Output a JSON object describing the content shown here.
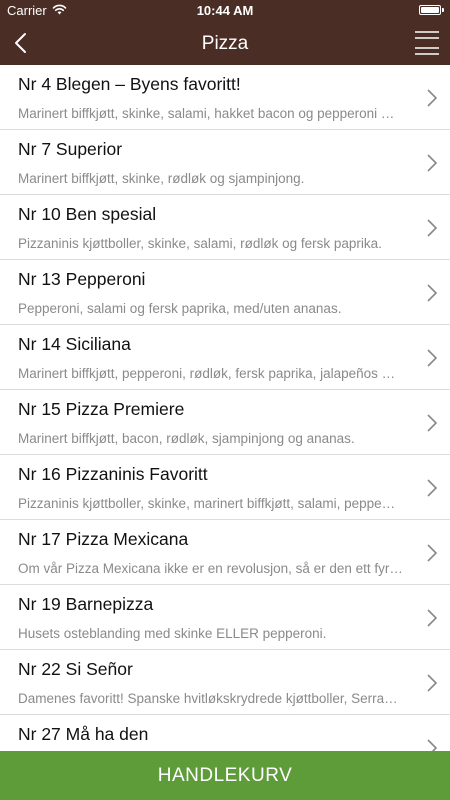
{
  "status_bar": {
    "carrier": "Carrier",
    "time": "10:44 AM",
    "wifi_icon": "wifi-icon",
    "battery_icon": "battery-icon"
  },
  "nav": {
    "title": "Pizza",
    "back_icon": "chevron-left-icon",
    "menu_icon": "hamburger-menu-icon"
  },
  "items": [
    {
      "title": "Nr 4 Blegen – Byens favoritt!",
      "description": "Marinert biffkjøtt, skinke, salami, hakket bacon og pepperoni …"
    },
    {
      "title": "Nr 7 Superior",
      "description": "Marinert biffkjøtt, skinke, rødløk og sjampinjong."
    },
    {
      "title": "Nr 10 Ben spesial",
      "description": "Pizzaninis kjøttboller, skinke, salami, rødløk og fersk paprika."
    },
    {
      "title": "Nr 13 Pepperoni",
      "description": "Pepperoni, salami og fersk paprika, med/uten ananas."
    },
    {
      "title": "Nr 14 Siciliana",
      "description": "Marinert biffkjøtt, pepperoni, rødløk, fersk paprika, jalapeños …"
    },
    {
      "title": "Nr 15 Pizza Premiere",
      "description": "Marinert biffkjøtt, bacon, rødløk, sjampinjong og ananas."
    },
    {
      "title": "Nr 16 Pizzaninis Favoritt",
      "description": "Pizzaninis kjøttboller, skinke, marinert biffkjøtt, salami, peppe…"
    },
    {
      "title": "Nr 17 Pizza Mexicana",
      "description": "Om vår Pizza Mexicana ikke er en revolusjon, så er den ett fyr…"
    },
    {
      "title": "Nr 19 Barnepizza",
      "description": "Husets osteblanding med skinke ELLER pepperoni."
    },
    {
      "title": "Nr 22 Si Señor",
      "description": "Damenes favoritt! Spanske hvitløkskrydrede kjøttboller, Serra…"
    },
    {
      "title": "Nr 27 Må ha den",
      "description": ""
    }
  ],
  "cart": {
    "label": "HANDLEKURV"
  },
  "colors": {
    "header_bg": "#4a2d24",
    "cart_bg": "#5e9b39",
    "title_text": "#111111",
    "desc_text": "#8a8a8a",
    "divider": "#dcdcdc"
  }
}
